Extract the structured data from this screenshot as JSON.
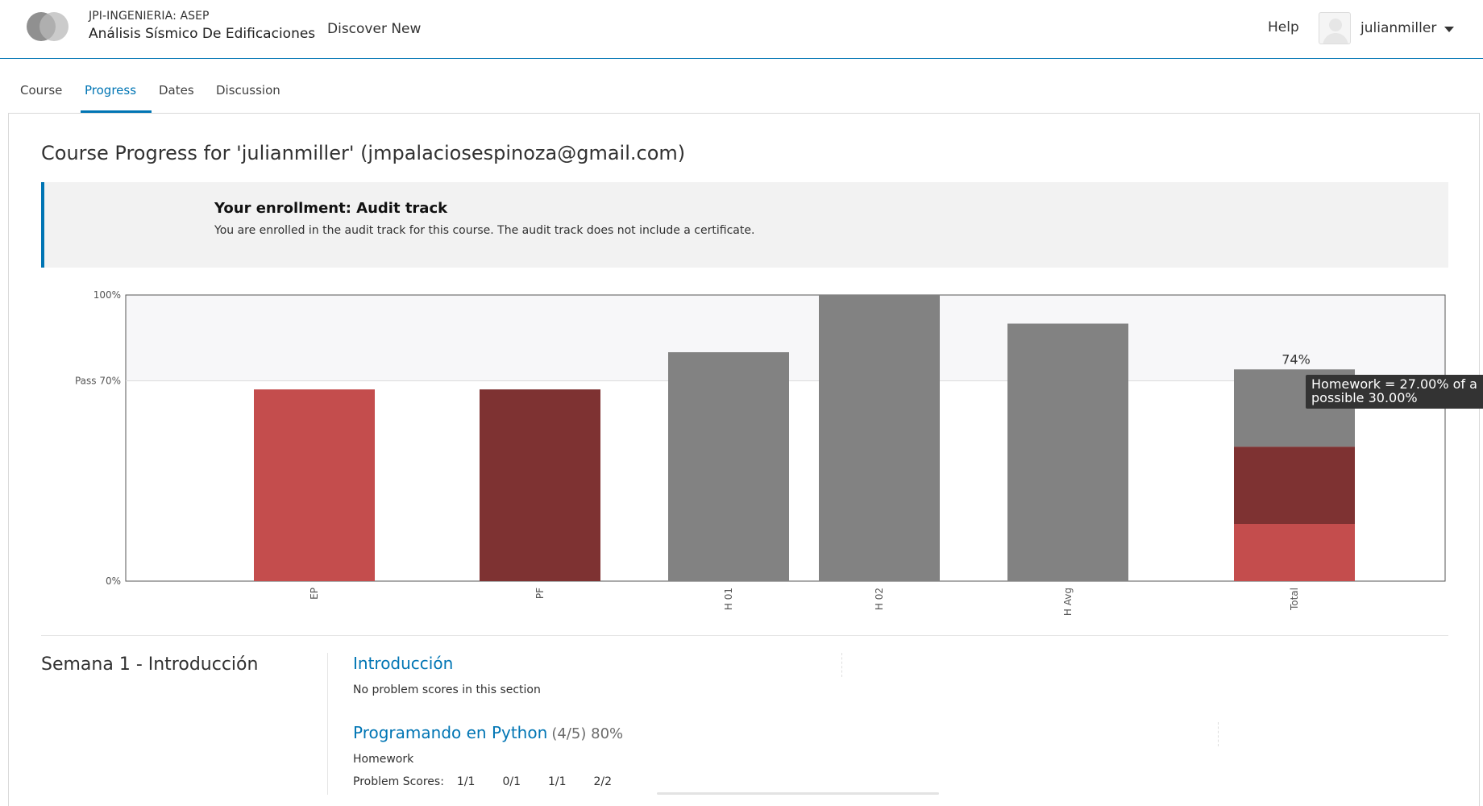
{
  "header": {
    "org": "JPI-INGENIERIA: ASEP",
    "course": "Análisis Sísmico De Edificaciones",
    "discover": "Discover New",
    "help": "Help",
    "username": "julianmiller"
  },
  "tabs": [
    {
      "label": "Course"
    },
    {
      "label": "Progress"
    },
    {
      "label": "Dates"
    },
    {
      "label": "Discussion"
    }
  ],
  "page_title": "Course Progress for 'julianmiller' (jmpalaciosespinoza@gmail.com)",
  "enrollment": {
    "title": "Your enrollment: Audit track",
    "text": "You are enrolled in the audit track for this course. The audit track does not include a certificate."
  },
  "tooltip": {
    "line1": "Homework = 27.00% of a",
    "line2": "possible 30.00%"
  },
  "chart_data": {
    "type": "bar",
    "title": "",
    "xlabel": "",
    "ylabel": "",
    "ylim": [
      0,
      100
    ],
    "y_tick_labels": [
      "0%",
      "Pass 70%",
      "100%"
    ],
    "y_tick_values": [
      0,
      70,
      100
    ],
    "pass_line": 70,
    "categories": [
      "EP",
      "PF",
      "H 01",
      "H 02",
      "H Avg",
      "Total"
    ],
    "values": [
      67,
      67,
      80,
      100,
      90,
      74
    ],
    "colors": [
      "#c44d4d",
      "#7e3232",
      "#828282",
      "#828282",
      "#828282",
      null
    ],
    "total_stack": [
      {
        "label": "EP",
        "value": 20,
        "color": "#c44d4d"
      },
      {
        "label": "PF",
        "value": 27,
        "color": "#7e3232"
      },
      {
        "label": "Homework",
        "value": 27,
        "color": "#828282"
      }
    ],
    "total_label": "74%",
    "legend": "none",
    "grid": false
  },
  "section": {
    "title": "Semana 1 - Introducción",
    "items": [
      {
        "title": "Introducción",
        "note": "No problem scores in this section"
      },
      {
        "title": "Programando en Python",
        "score": "(4/5) 80%",
        "type": "Homework",
        "scores_label": "Problem Scores:",
        "scores": [
          "1/1",
          "0/1",
          "1/1",
          "2/2"
        ]
      }
    ]
  }
}
